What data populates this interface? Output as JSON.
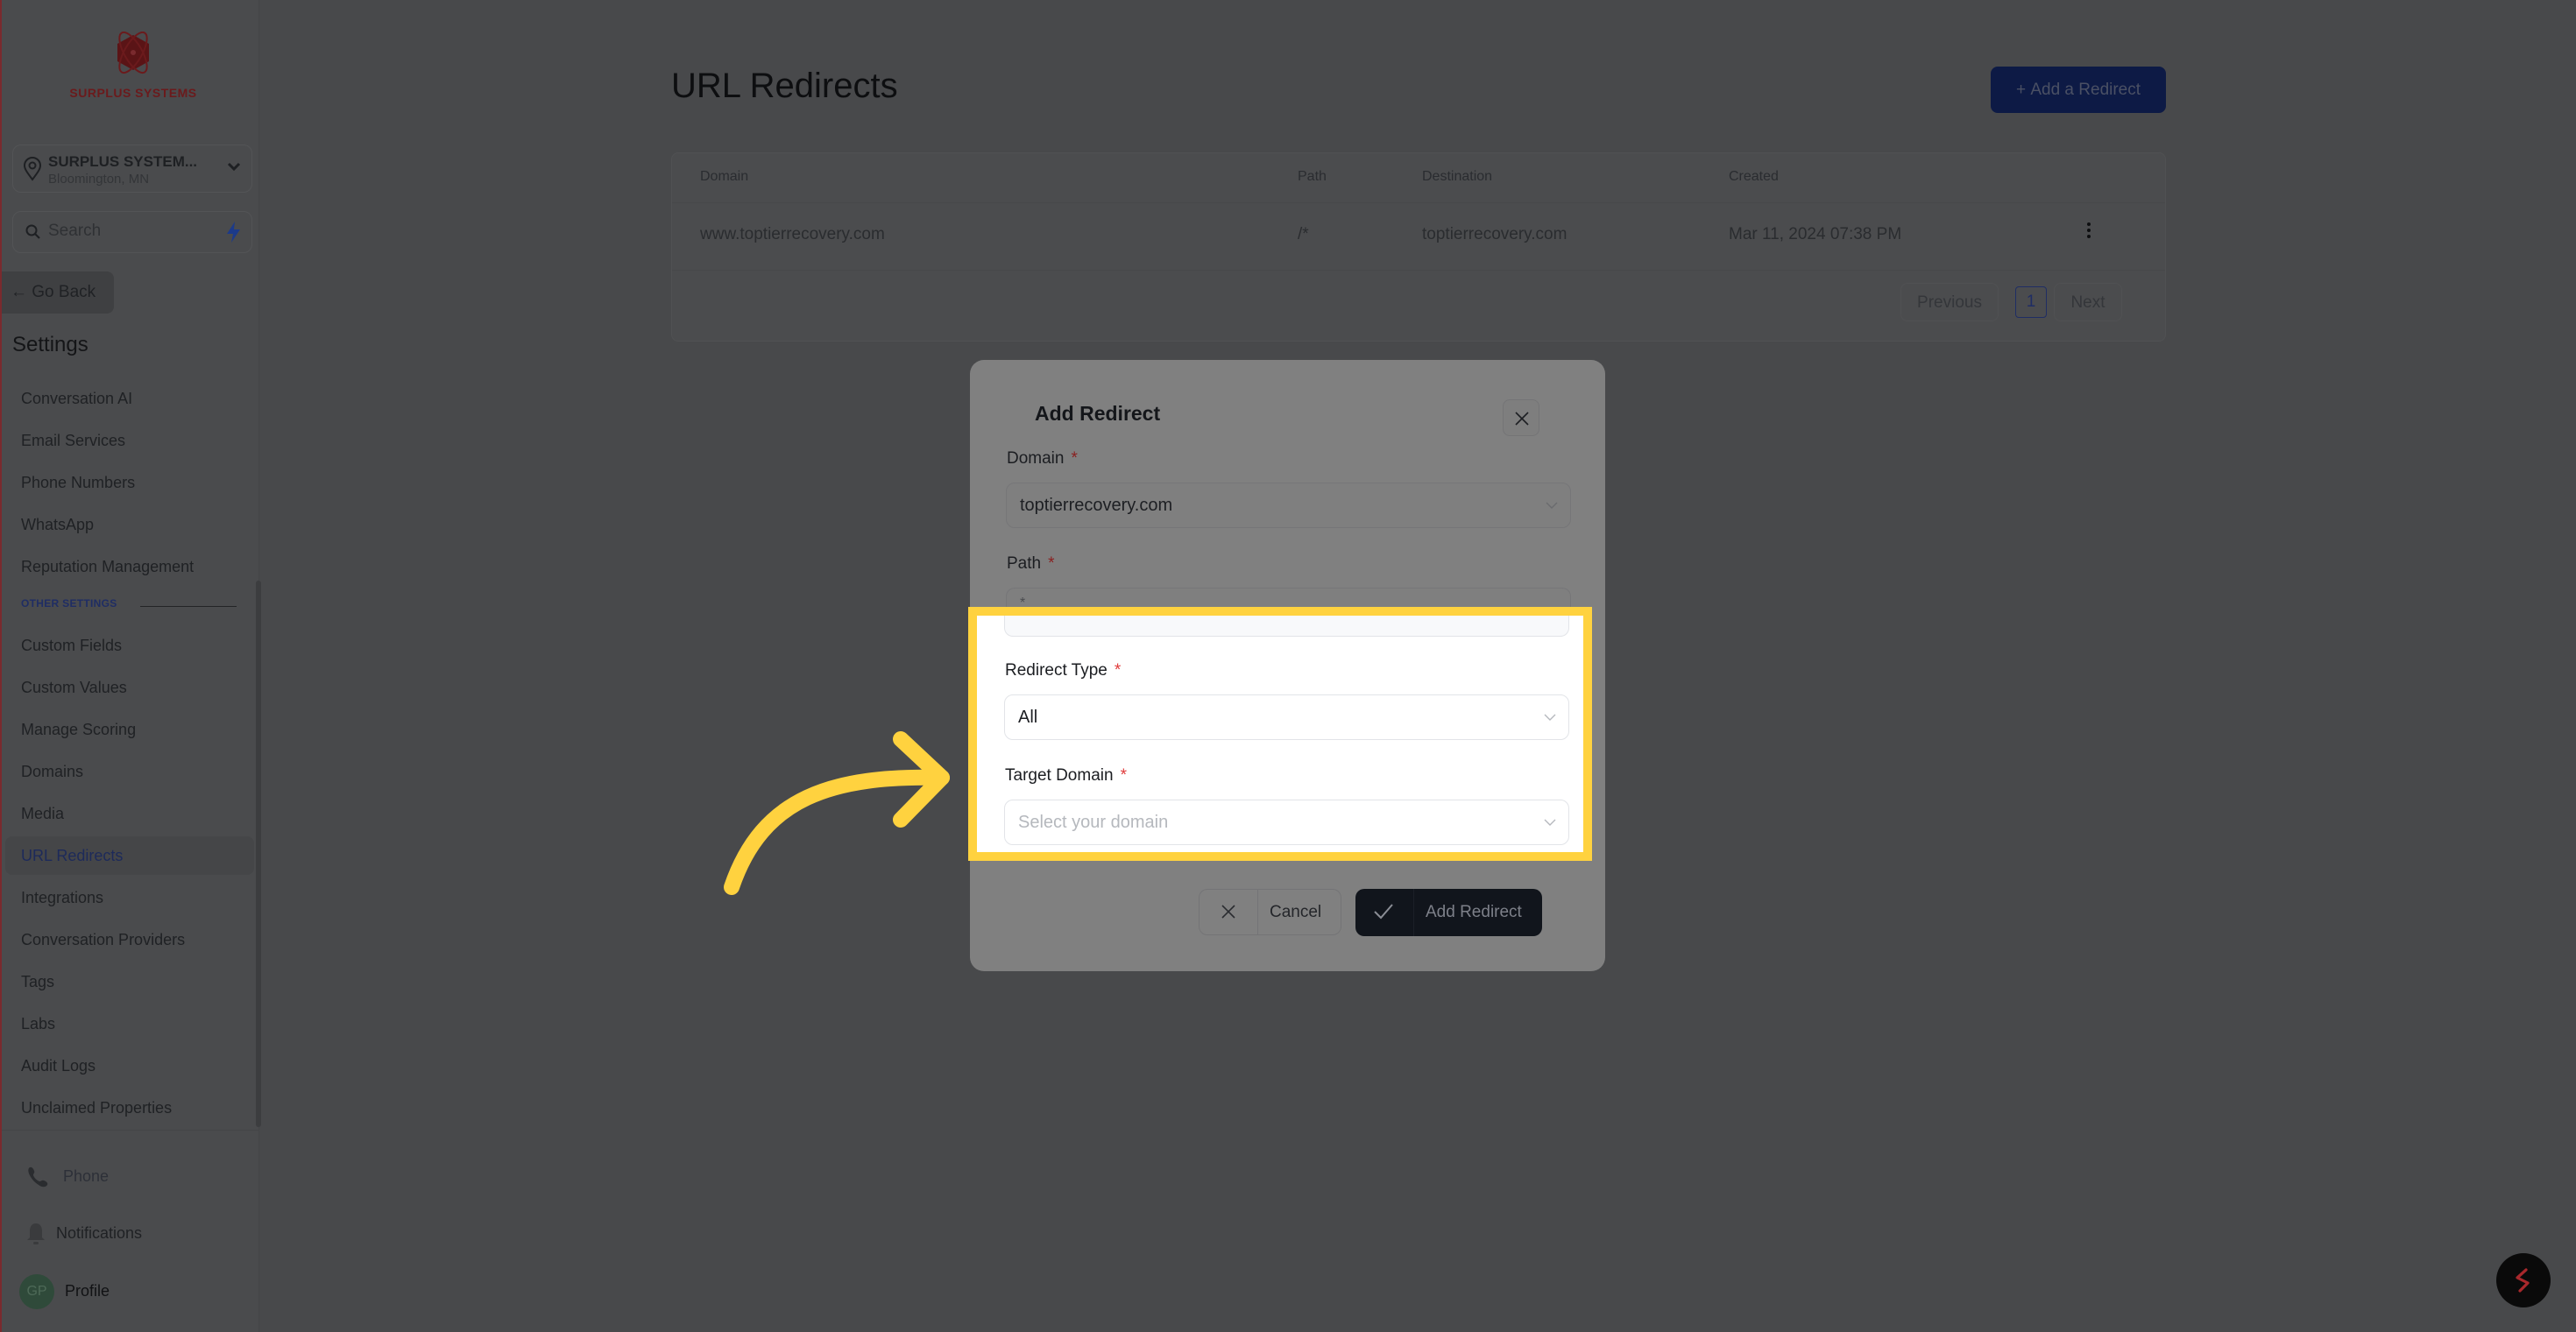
{
  "sidebar": {
    "brand": "SURPLUS SYSTEMS",
    "location": {
      "name": "SURPLUS SYSTEM...",
      "city": "Bloomington, MN"
    },
    "search": {
      "placeholder": "Search"
    },
    "go_back": "Go Back",
    "section_title": "Settings",
    "items": [
      {
        "label": "Conversation AI"
      },
      {
        "label": "Email Services"
      },
      {
        "label": "Phone Numbers"
      },
      {
        "label": "WhatsApp"
      },
      {
        "label": "Reputation Management"
      }
    ],
    "other_settings_label": "OTHER SETTINGS",
    "other_items": [
      {
        "label": "Custom Fields"
      },
      {
        "label": "Custom Values"
      },
      {
        "label": "Manage Scoring"
      },
      {
        "label": "Domains"
      },
      {
        "label": "Media"
      },
      {
        "label": "URL Redirects",
        "active": true
      },
      {
        "label": "Integrations"
      },
      {
        "label": "Conversation Providers"
      },
      {
        "label": "Tags"
      },
      {
        "label": "Labs"
      },
      {
        "label": "Audit Logs"
      },
      {
        "label": "Unclaimed Properties"
      }
    ],
    "bottom": {
      "phone": "Phone",
      "notifications": "Notifications",
      "profile": "Profile",
      "avatar_initials": "GP"
    }
  },
  "main": {
    "title": "URL Redirects",
    "add_button": "Add a Redirect",
    "table": {
      "columns": [
        "Domain",
        "Path",
        "Destination",
        "Created"
      ],
      "rows": [
        {
          "domain": "www.toptierrecovery.com",
          "path": "/*",
          "destination": "toptierrecovery.com",
          "created": "Mar 11, 2024 07:38 PM"
        }
      ]
    },
    "pagination": {
      "previous": "Previous",
      "current": "1",
      "next": "Next"
    }
  },
  "modal": {
    "title": "Add Redirect",
    "fields": {
      "domain": {
        "label": "Domain",
        "required": "*",
        "value": "toptierrecovery.com"
      },
      "path": {
        "label": "Path",
        "required": "*",
        "value": "*"
      },
      "redirect_type": {
        "label": "Redirect Type",
        "required": "*",
        "value": "All"
      },
      "target_domain": {
        "label": "Target Domain",
        "required": "*",
        "placeholder": "Select your domain"
      }
    },
    "cancel": "Cancel",
    "submit": "Add Redirect"
  },
  "colors": {
    "highlight": "#ffd23f",
    "primary_button": "#0d1a45",
    "brand_red": "#b0282d",
    "required": "#e03b3b"
  }
}
